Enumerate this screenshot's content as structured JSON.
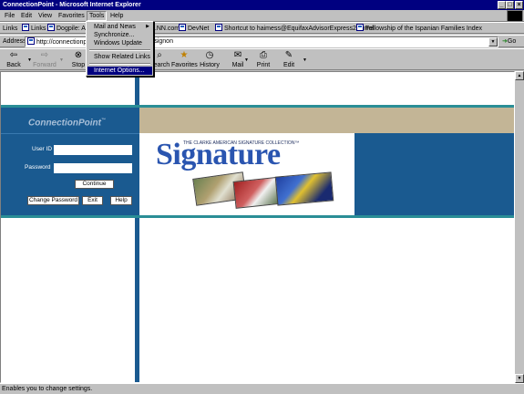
{
  "window": {
    "title": "ConnectionPoint - Microsoft Internet Explorer"
  },
  "menus": [
    "File",
    "Edit",
    "View",
    "Favorites",
    "Tools",
    "Help"
  ],
  "links": {
    "label": "Links",
    "items": [
      "Links",
      "Dogpile: All",
      "...NN.com",
      "DevNet",
      "Shortcut to haimess@EquifaxAdvisorExpress20.html",
      "Fellowship of the Ispanian Families Index"
    ]
  },
  "address": {
    "label": "Address",
    "url": "http://connectionpo",
    "url_tail": "rsignon",
    "go_label": "Go"
  },
  "toolbar": {
    "back": "Back",
    "forward": "Forward",
    "stop": "Stop",
    "search": "Search",
    "favorites": "Favorites",
    "history": "History",
    "mail": "Mail",
    "print": "Print",
    "edit": "Edit"
  },
  "tools_menu": {
    "items": [
      "Mail and News",
      "Synchronize...",
      "Windows Update",
      "Show Related Links",
      "Internet Options..."
    ],
    "highlighted": "Internet Options..."
  },
  "page": {
    "brand": "ConnectionPoint",
    "tm": "™",
    "userid_label": "User ID",
    "password_label": "Password",
    "continue_label": "Continue",
    "change_password_label": "Change Password",
    "exit_label": "Exit",
    "help_label": "Help",
    "banner_tag": "THE CLARKE AMERICAN SIGNATURE COLLECTION™",
    "banner_title": "Signature"
  },
  "status": {
    "text": "Enables you to change settings."
  },
  "colors": {
    "titlebar": "#000080",
    "panel": "#1a5a90",
    "tan": "#c3b596",
    "teal": "#2a8e96"
  }
}
